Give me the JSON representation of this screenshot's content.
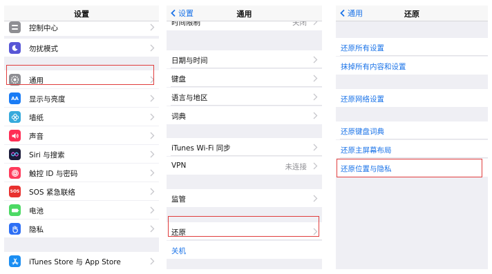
{
  "panel1": {
    "title": "设置",
    "partial_item": "控制中心",
    "items": [
      {
        "label": "勿扰模式"
      },
      {
        "label": "通用"
      },
      {
        "label": "显示与亮度",
        "icon_text": "AA"
      },
      {
        "label": "墙纸"
      },
      {
        "label": "声音"
      },
      {
        "label": "Siri 与搜索"
      },
      {
        "label": "触控 ID 与密码"
      },
      {
        "label": "SOS 紧急联络",
        "icon_text": "SOS"
      },
      {
        "label": "电池"
      },
      {
        "label": "隐私"
      },
      {
        "label": "iTunes Store 与 App Store"
      }
    ],
    "colors": {
      "dnd": "#5856d6",
      "general": "#8e8e93",
      "display": "#1a7cf5",
      "wallpaper": "#36aadc",
      "sounds": "#ff2d55",
      "siri": "#1c1c3a",
      "touchid": "#ff3b5c",
      "sos": "#e8312f",
      "battery": "#4cd964",
      "privacy": "#2d6ff5",
      "itunes": "#1b8ef2"
    }
  },
  "panel2": {
    "back_label": "设置",
    "title": "通用",
    "partial_item": "时间限制",
    "partial_value": "关闭",
    "items": [
      {
        "label": "日期与时间"
      },
      {
        "label": "键盘"
      },
      {
        "label": "语言与地区"
      },
      {
        "label": "词典"
      },
      {
        "label": "iTunes Wi-Fi 同步"
      },
      {
        "label": "VPN",
        "value": "未连接"
      },
      {
        "label": "监管"
      },
      {
        "label": "还原"
      },
      {
        "label": "关机"
      }
    ]
  },
  "panel3": {
    "back_label": "通用",
    "title": "还原",
    "items": [
      {
        "label": "还原所有设置"
      },
      {
        "label": "抹掉所有内容和设置"
      },
      {
        "label": "还原网络设置"
      },
      {
        "label": "还原键盘词典"
      },
      {
        "label": "还原主屏幕布局"
      },
      {
        "label": "还原位置与隐私"
      }
    ]
  },
  "accent_color": "#1a73e8",
  "highlight_color": "#e03c3c"
}
